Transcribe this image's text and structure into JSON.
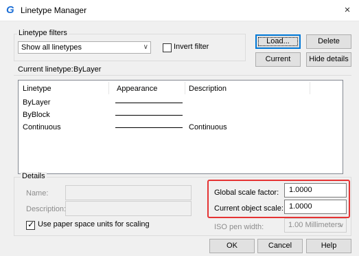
{
  "window": {
    "title": "Linetype Manager",
    "close_glyph": "×",
    "app_icon_glyph": "G"
  },
  "filters": {
    "group_label": "Linetype filters",
    "combo_value": "Show all linetypes",
    "invert_label": "Invert filter",
    "invert_checked": false
  },
  "buttons": {
    "load": "Load...",
    "delete": "Delete",
    "current": "Current",
    "hide_details": "Hide details",
    "ok": "OK",
    "cancel": "Cancel",
    "help": "Help"
  },
  "current_linetype": {
    "label": "Current linetype:",
    "value": "ByLayer"
  },
  "list": {
    "columns": [
      "Linetype",
      "Appearance",
      "Description"
    ],
    "rows": [
      {
        "name": "ByLayer",
        "description": ""
      },
      {
        "name": "ByBlock",
        "description": ""
      },
      {
        "name": "Continuous",
        "description": "Continuous"
      }
    ]
  },
  "details": {
    "group_label": "Details",
    "name_label": "Name:",
    "name_value": "",
    "description_label": "Description:",
    "description_value": "",
    "paper_space_label": "Use paper space units for scaling",
    "paper_space_checked": true,
    "global_scale_label": "Global scale factor:",
    "global_scale_value": "1.0000",
    "object_scale_label": "Current object scale:",
    "object_scale_value": "1.0000",
    "iso_pen_label": "ISO pen width:",
    "iso_pen_value": "1.00 Millimeters"
  },
  "colors": {
    "highlight_frame": "#e53333",
    "accent": "#0078d7",
    "app_icon": "#1d6fd6"
  },
  "icons": [
    "app-logo-icon",
    "close-icon",
    "dropdown-arrow-icon",
    "checkbox-checked-icon"
  ]
}
